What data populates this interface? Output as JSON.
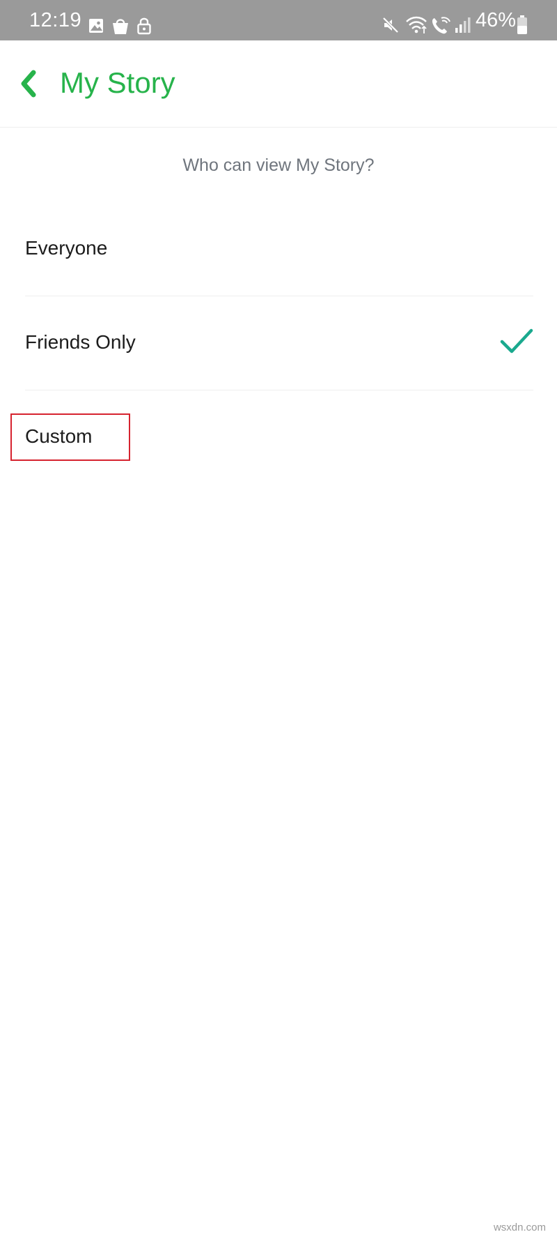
{
  "status_bar": {
    "time": "12:19",
    "battery": "46%",
    "icons": [
      "image-icon",
      "shopping-bag-icon",
      "lock-icon",
      "mute-icon",
      "wifi-icon",
      "wifi-calling-icon",
      "signal-icon",
      "battery-icon"
    ]
  },
  "header": {
    "title": "My Story",
    "back_icon": "chevron-left-icon"
  },
  "content": {
    "question": "Who can view My Story?",
    "options": [
      {
        "label": "Everyone",
        "selected": false
      },
      {
        "label": "Friends Only",
        "selected": true
      },
      {
        "label": "Custom",
        "selected": false
      }
    ]
  },
  "colors": {
    "accent_green": "#27b34b",
    "check_teal": "#1aa98e",
    "highlight_red": "#d6232f",
    "status_bar": "#9a9a9a"
  },
  "watermark": "wsxdn.com"
}
